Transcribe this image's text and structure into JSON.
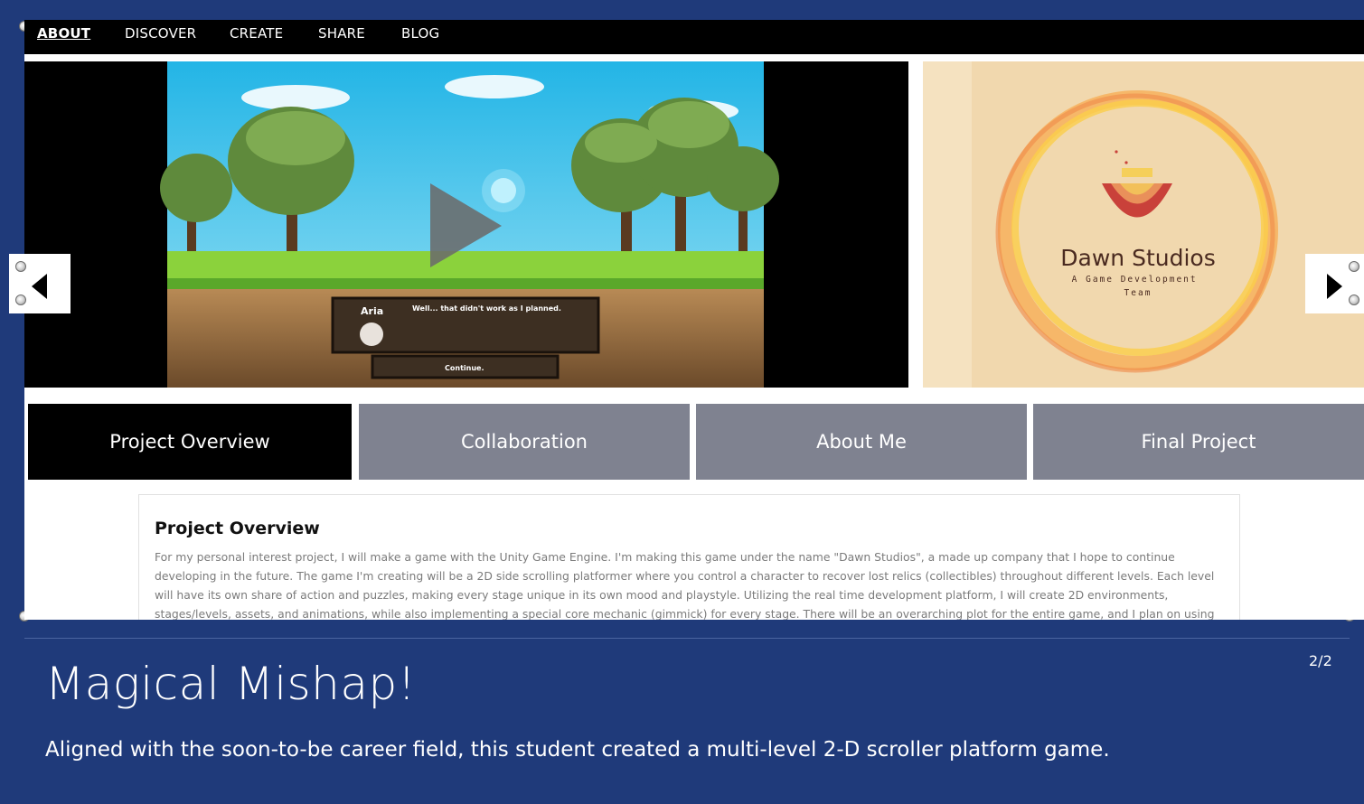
{
  "nav": {
    "items": [
      "ABOUT",
      "DISCOVER",
      "CREATE",
      "SHARE",
      "BLOG"
    ],
    "active": "ABOUT"
  },
  "video": {
    "dialog_speaker": "Aria",
    "dialog_text": "Well... that didn't work as I planned.",
    "continue_label": "Continue."
  },
  "promo": {
    "brand_name": "Dawn Studios",
    "tagline": "A Game Development Team"
  },
  "tabs": [
    {
      "label": "Project Overview",
      "active": true
    },
    {
      "label": "Collaboration",
      "active": false
    },
    {
      "label": "About Me",
      "active": false
    },
    {
      "label": "Final Project",
      "active": false
    }
  ],
  "overview": {
    "heading": "Project Overview",
    "body": "For my personal interest project, I will make a game with the Unity Game Engine. I'm making this game under the name \"Dawn Studios\", a made up company that I hope to continue developing in the future. The game I'm creating will be a 2D side scrolling platformer where you control a character to recover lost relics (collectibles) throughout different levels. Each level will have its own share of action and puzzles, making every stage unique in its own mood and playstyle. Utilizing the real time development platform, I will create 2D environments, stages/levels, assets, and animations, while also implementing a special core mechanic (gimmick) for every stage. There will be an overarching plot for the entire game, and I plan on using"
  },
  "caption": {
    "title": "Magical Mishap!",
    "subtitle": "Aligned with the soon-to-be career field, this student created a multi-level 2-D scroller platform game.",
    "counter": "2/2"
  },
  "colors": {
    "background": "#1f3a7a",
    "tab_active": "#000000",
    "tab_inactive": "#7f8290",
    "promo_bg": "#f1d8ae"
  }
}
